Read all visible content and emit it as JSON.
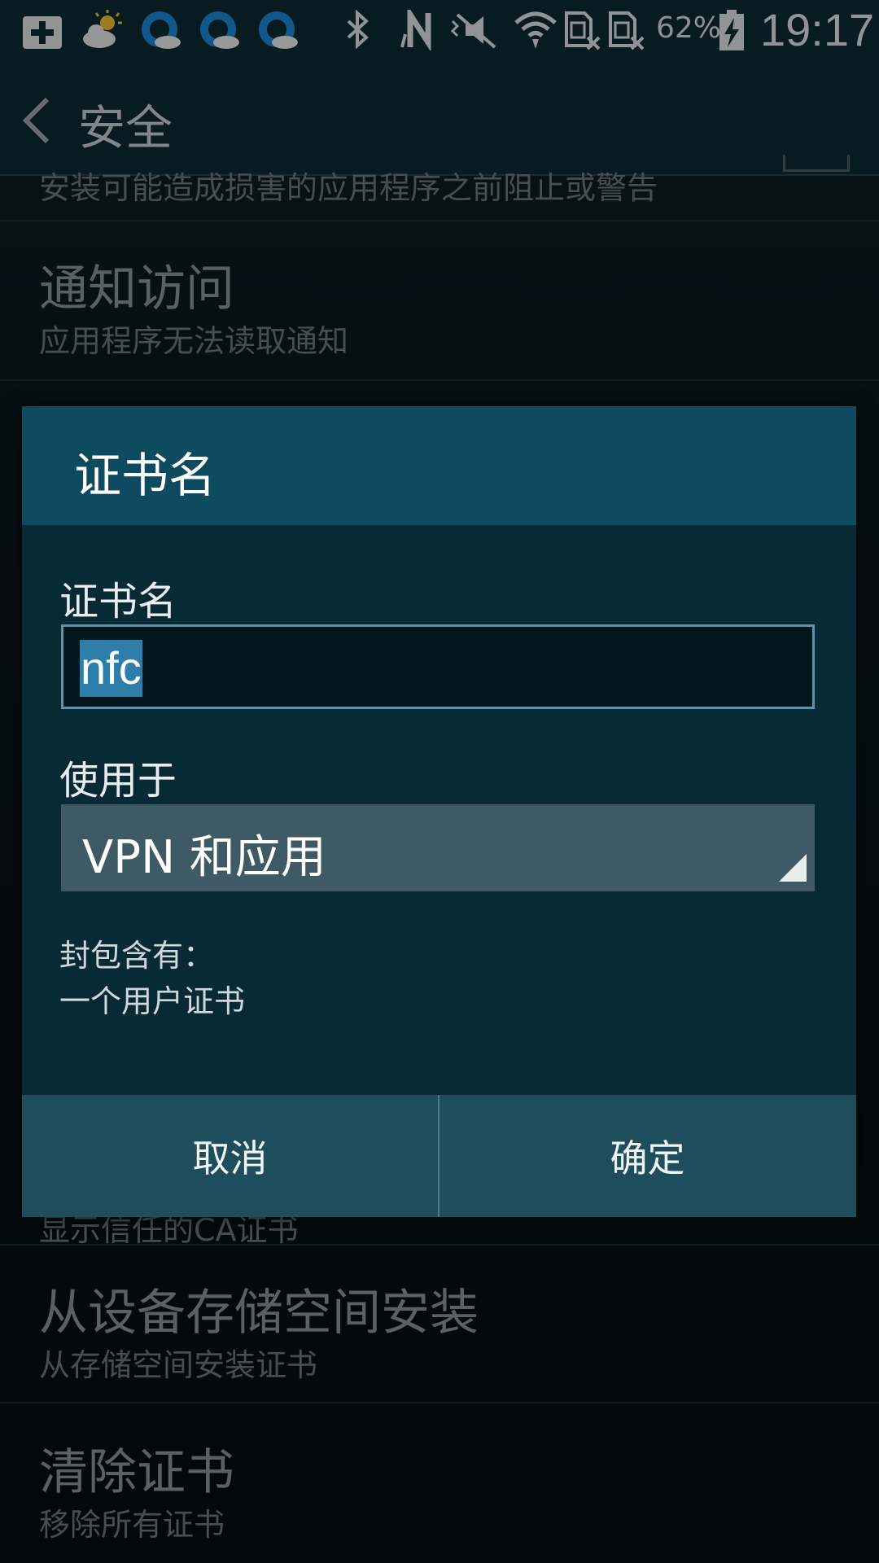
{
  "status_bar": {
    "battery_percent": "62%",
    "time": "19:17",
    "icons": [
      "add-notification-icon",
      "weather-icon",
      "app-notification-icon",
      "app-notification-icon",
      "app-notification-icon",
      "bluetooth-icon",
      "nfc-icon",
      "vibrate-mute-icon",
      "wifi-icon",
      "sim-no-signal-icon",
      "sim-no-signal-icon",
      "battery-charging-icon"
    ]
  },
  "action_bar": {
    "title": "安全"
  },
  "background_list": {
    "rows": [
      {
        "title": "",
        "subtitle": "安装可能造成损害的应用程序之前阻止或警告"
      },
      {
        "title": "通知访问",
        "subtitle": "应用程序无法读取通知"
      },
      {
        "title": "",
        "subtitle": "显示信任的CA证书"
      },
      {
        "title": "从设备存储空间安装",
        "subtitle": "从存储空间安装证书"
      },
      {
        "title": "清除证书",
        "subtitle": "移除所有证书"
      }
    ]
  },
  "dialog": {
    "title": "证书名",
    "name_label": "证书名",
    "name_value": "nfc",
    "usage_label": "使用于",
    "usage_value": "VPN 和应用",
    "package_label": "封包含有：",
    "package_item": "一个用户证书",
    "cancel_label": "取消",
    "ok_label": "确定"
  },
  "colors": {
    "dialog_header": "#0e4b5e",
    "dialog_body": "#082a35",
    "button_bar": "#1e4e5c",
    "selection_highlight": "#2d7ea8",
    "input_border": "#5a93ad"
  }
}
